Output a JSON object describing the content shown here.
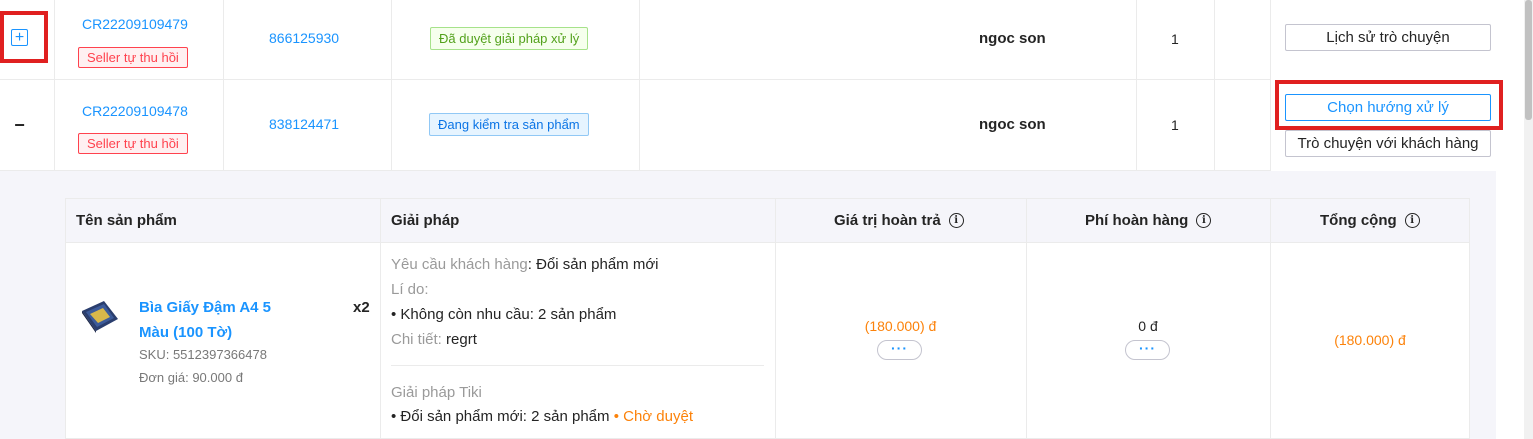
{
  "rows": [
    {
      "code": "CR22209109479",
      "badge": "Seller tự thu hồi",
      "order_id": "866125930",
      "status": "Đã duyệt giải pháp xử lý",
      "customer": "ngoc son",
      "qty": "1",
      "actions": [
        "Lịch sử trò chuyện"
      ]
    },
    {
      "code": "CR22209109478",
      "badge": "Seller tự thu hồi",
      "order_id": "838124471",
      "status": "Đang kiểm tra sản phẩm",
      "customer": "ngoc son",
      "qty": "1",
      "actions": [
        "Chọn hướng xử lý",
        "Trò chuyện với khách hàng"
      ]
    }
  ],
  "detail": {
    "headers": {
      "product": "Tên sản phẩm",
      "solution": "Giải pháp",
      "refund_value": "Giá trị hoàn trả",
      "return_fee": "Phí hoàn hàng",
      "total": "Tổng cộng"
    },
    "product": {
      "name": "Bìa Giấy Đậm A4 5 Màu (100 Tờ)",
      "qty": "x2",
      "sku": "SKU: 5512397366478",
      "unit_price": "Đơn giá: 90.000 đ"
    },
    "solution": {
      "request_label": "Yêu cầu khách hàng",
      "request_value": ": Đổi sản phẩm mới",
      "reason_label": "Lí do:",
      "reason_item": "• Không còn nhu cầu: 2 sản phẩm",
      "detail_label": "Chi tiết:",
      "detail_value": " regrt",
      "tiki_label": "Giải pháp Tiki",
      "tiki_item": "• Đổi sản phẩm mới: 2 sản phẩm",
      "tiki_status": " • Chờ duyệt"
    },
    "refund_value": "(180.000) đ",
    "return_fee": "0 đ",
    "total": "(180.000) đ",
    "more_label": "···"
  },
  "colors": {
    "accent": "#1a94ff",
    "highlight": "#e02020",
    "orange": "#fc820a"
  }
}
